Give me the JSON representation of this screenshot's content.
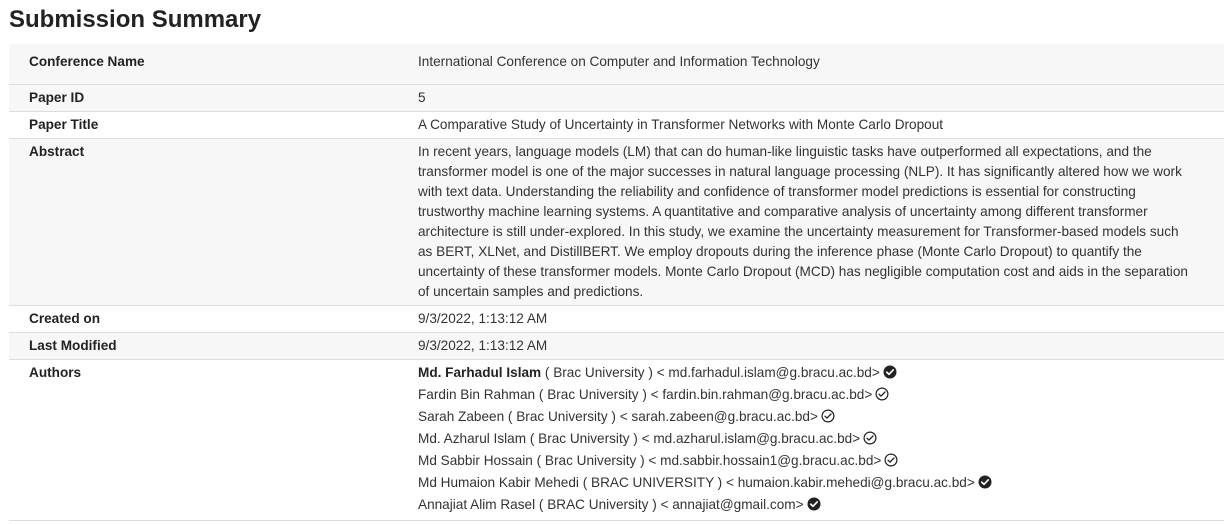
{
  "page": {
    "title": "Submission Summary"
  },
  "summary": {
    "conference": {
      "label": "Conference Name",
      "value": "International Conference on Computer and Information Technology"
    },
    "paper_id": {
      "label": "Paper ID",
      "value": "5"
    },
    "paper_title": {
      "label": "Paper Title",
      "value": "A Comparative Study of Uncertainty in Transformer Networks with Monte Carlo Dropout"
    },
    "abstract": {
      "label": "Abstract",
      "value": "In recent years, language models (LM) that can do human-like linguistic tasks have outperformed all expectations, and the transformer model is one of the major successes in natural language processing (NLP). It has significantly altered how we work with text data. Understanding the reliability and confidence of transformer model predictions is essential for constructing trustworthy machine learning systems. A quantitative and comparative analysis of uncertainty among different transformer architecture is still under-explored. In this study, we examine the uncertainty measurement for Transformer-based models such as BERT, XLNet, and DistillBERT. We employ dropouts during the inference phase (Monte Carlo Dropout) to quantify the uncertainty of these transformer models. Monte Carlo Dropout (MCD) has negligible computation cost and aids in the separation of uncertain samples and predictions."
    },
    "created_on": {
      "label": "Created on",
      "value": "9/3/2022, 1:13:12 AM"
    },
    "last_modified": {
      "label": "Last Modified",
      "value": "9/3/2022, 1:13:12 AM"
    },
    "authors_label": "Authors",
    "authors": [
      {
        "name": "Md. Farhadul Islam",
        "affiliation": " ( Brac University ) < md.farhadul.islam@g.bracu.ac.bd>",
        "icon": "check-circle-filled-icon"
      },
      {
        "name": "Fardin Bin Rahman",
        "affiliation": " ( Brac University ) < fardin.bin.rahman@g.bracu.ac.bd>",
        "icon": "check-circle-outline-icon"
      },
      {
        "name": "Sarah Zabeen",
        "affiliation": " ( Brac University ) < sarah.zabeen@g.bracu.ac.bd>",
        "icon": "check-circle-outline-icon"
      },
      {
        "name": "Md. Azharul Islam",
        "affiliation": " ( Brac University ) < md.azharul.islam@g.bracu.ac.bd>",
        "icon": "check-circle-outline-icon"
      },
      {
        "name": "Md Sabbir Hossain",
        "affiliation": " ( Brac University ) < md.sabbir.hossain1@g.bracu.ac.bd>",
        "icon": "check-circle-outline-icon"
      },
      {
        "name": "Md Humaion Kabir Mehedi",
        "affiliation": " ( BRAC UNIVERSITY ) < humaion.kabir.mehedi@g.bracu.ac.bd>",
        "icon": "check-circle-filled-icon"
      },
      {
        "name": "Annajiat Alim Rasel",
        "affiliation": " ( BRAC University ) < annajiat@gmail.com>",
        "icon": "check-circle-filled-icon"
      }
    ]
  }
}
